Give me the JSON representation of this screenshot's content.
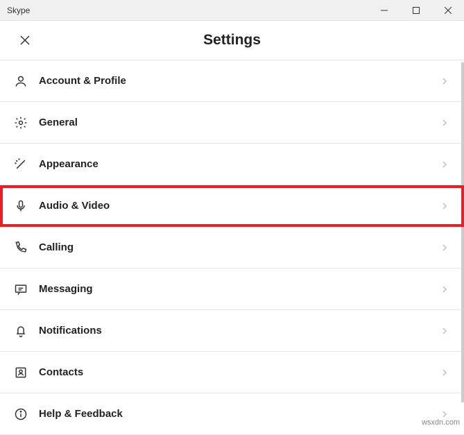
{
  "window": {
    "title": "Skype"
  },
  "header": {
    "title": "Settings"
  },
  "rows": [
    {
      "label": "Account & Profile"
    },
    {
      "label": "General"
    },
    {
      "label": "Appearance"
    },
    {
      "label": "Audio & Video"
    },
    {
      "label": "Calling"
    },
    {
      "label": "Messaging"
    },
    {
      "label": "Notifications"
    },
    {
      "label": "Contacts"
    },
    {
      "label": "Help & Feedback"
    }
  ],
  "watermark": "wsxdn.com"
}
